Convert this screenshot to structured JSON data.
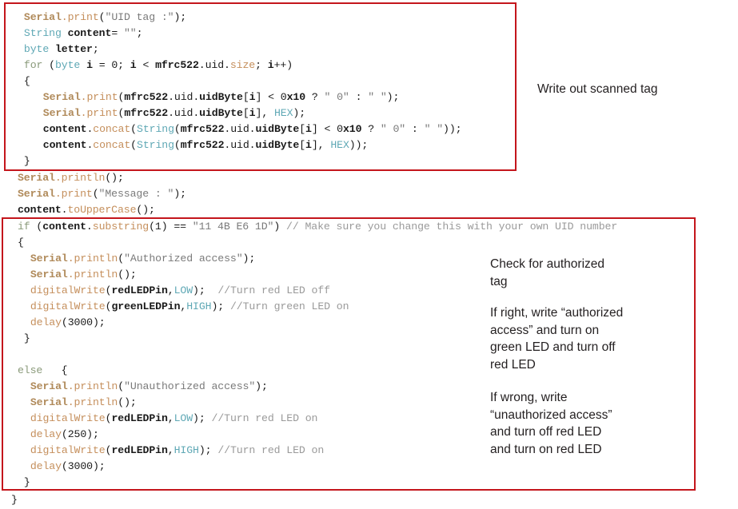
{
  "document": {
    "kind": "annotated-arduino-code-slide",
    "background_color": "#ffffff",
    "annotation_color": "#c4161c"
  },
  "code": {
    "lines": [
      {
        "indent": 2,
        "tokens": [
          {
            "text": "Serial",
            "style": "obj"
          },
          {
            "text": ".print",
            "style": "method"
          },
          {
            "text": "(",
            "style": "plain"
          },
          {
            "text": "\"UID tag :\"",
            "style": "str"
          },
          {
            "text": ");",
            "style": "plain"
          }
        ]
      },
      {
        "indent": 2,
        "tokens": [
          {
            "text": "String",
            "style": "type"
          },
          {
            "text": " ",
            "style": "plain"
          },
          {
            "text": "content",
            "style": "bold"
          },
          {
            "text": "= ",
            "style": "plain"
          },
          {
            "text": "\"\"",
            "style": "str"
          },
          {
            "text": ";",
            "style": "plain"
          }
        ]
      },
      {
        "indent": 2,
        "tokens": [
          {
            "text": "byte",
            "style": "type"
          },
          {
            "text": " ",
            "style": "plain"
          },
          {
            "text": "letter",
            "style": "bold"
          },
          {
            "text": ";",
            "style": "plain"
          }
        ]
      },
      {
        "indent": 2,
        "tokens": [
          {
            "text": "for",
            "style": "kw"
          },
          {
            "text": " (",
            "style": "plain"
          },
          {
            "text": "byte",
            "style": "type"
          },
          {
            "text": " ",
            "style": "plain"
          },
          {
            "text": "i",
            "style": "bold"
          },
          {
            "text": " = 0; ",
            "style": "plain"
          },
          {
            "text": "i",
            "style": "bold"
          },
          {
            "text": " < ",
            "style": "plain"
          },
          {
            "text": "mfrc522",
            "style": "bold"
          },
          {
            "text": ".uid.",
            "style": "plain"
          },
          {
            "text": "size",
            "style": "method"
          },
          {
            "text": "; ",
            "style": "plain"
          },
          {
            "text": "i",
            "style": "bold"
          },
          {
            "text": "++)",
            "style": "plain"
          }
        ]
      },
      {
        "indent": 2,
        "tokens": [
          {
            "text": "{",
            "style": "plain"
          }
        ]
      },
      {
        "indent": 5,
        "tokens": [
          {
            "text": "Serial",
            "style": "obj"
          },
          {
            "text": ".print",
            "style": "method"
          },
          {
            "text": "(",
            "style": "plain"
          },
          {
            "text": "mfrc522",
            "style": "bold"
          },
          {
            "text": ".uid.",
            "style": "plain"
          },
          {
            "text": "uidByte",
            "style": "bold"
          },
          {
            "text": "[",
            "style": "plain"
          },
          {
            "text": "i",
            "style": "bold"
          },
          {
            "text": "] < 0",
            "style": "plain"
          },
          {
            "text": "x10",
            "style": "bold"
          },
          {
            "text": " ? ",
            "style": "plain"
          },
          {
            "text": "\" 0\"",
            "style": "str"
          },
          {
            "text": " : ",
            "style": "plain"
          },
          {
            "text": "\" \"",
            "style": "str"
          },
          {
            "text": ");",
            "style": "plain"
          }
        ]
      },
      {
        "indent": 5,
        "tokens": [
          {
            "text": "Serial",
            "style": "obj"
          },
          {
            "text": ".print",
            "style": "method"
          },
          {
            "text": "(",
            "style": "plain"
          },
          {
            "text": "mfrc522",
            "style": "bold"
          },
          {
            "text": ".uid.",
            "style": "plain"
          },
          {
            "text": "uidByte",
            "style": "bold"
          },
          {
            "text": "[",
            "style": "plain"
          },
          {
            "text": "i",
            "style": "bold"
          },
          {
            "text": "], ",
            "style": "plain"
          },
          {
            "text": "HEX",
            "style": "type"
          },
          {
            "text": ");",
            "style": "plain"
          }
        ]
      },
      {
        "indent": 5,
        "tokens": [
          {
            "text": "content",
            "style": "bold"
          },
          {
            "text": ".",
            "style": "plain"
          },
          {
            "text": "concat",
            "style": "func"
          },
          {
            "text": "(",
            "style": "plain"
          },
          {
            "text": "String",
            "style": "type"
          },
          {
            "text": "(",
            "style": "plain"
          },
          {
            "text": "mfrc522",
            "style": "bold"
          },
          {
            "text": ".uid.",
            "style": "plain"
          },
          {
            "text": "uidByte",
            "style": "bold"
          },
          {
            "text": "[",
            "style": "plain"
          },
          {
            "text": "i",
            "style": "bold"
          },
          {
            "text": "] < 0",
            "style": "plain"
          },
          {
            "text": "x10",
            "style": "bold"
          },
          {
            "text": " ? ",
            "style": "plain"
          },
          {
            "text": "\" 0\"",
            "style": "str"
          },
          {
            "text": " : ",
            "style": "plain"
          },
          {
            "text": "\" \"",
            "style": "str"
          },
          {
            "text": "));",
            "style": "plain"
          }
        ]
      },
      {
        "indent": 5,
        "tokens": [
          {
            "text": "content",
            "style": "bold"
          },
          {
            "text": ".",
            "style": "plain"
          },
          {
            "text": "concat",
            "style": "func"
          },
          {
            "text": "(",
            "style": "plain"
          },
          {
            "text": "String",
            "style": "type"
          },
          {
            "text": "(",
            "style": "plain"
          },
          {
            "text": "mfrc522",
            "style": "bold"
          },
          {
            "text": ".uid.",
            "style": "plain"
          },
          {
            "text": "uidByte",
            "style": "bold"
          },
          {
            "text": "[",
            "style": "plain"
          },
          {
            "text": "i",
            "style": "bold"
          },
          {
            "text": "], ",
            "style": "plain"
          },
          {
            "text": "HEX",
            "style": "type"
          },
          {
            "text": "));",
            "style": "plain"
          }
        ]
      },
      {
        "indent": 2,
        "tokens": [
          {
            "text": "}",
            "style": "plain"
          }
        ]
      },
      {
        "indent": 1,
        "tokens": [
          {
            "text": "Serial",
            "style": "obj"
          },
          {
            "text": ".println",
            "style": "method"
          },
          {
            "text": "();",
            "style": "plain"
          }
        ]
      },
      {
        "indent": 1,
        "tokens": [
          {
            "text": "Serial",
            "style": "obj"
          },
          {
            "text": ".print",
            "style": "method"
          },
          {
            "text": "(",
            "style": "plain"
          },
          {
            "text": "\"Message : \"",
            "style": "str"
          },
          {
            "text": ");",
            "style": "plain"
          }
        ]
      },
      {
        "indent": 1,
        "tokens": [
          {
            "text": "content",
            "style": "bold"
          },
          {
            "text": ".",
            "style": "plain"
          },
          {
            "text": "toUpperCase",
            "style": "func"
          },
          {
            "text": "();",
            "style": "plain"
          }
        ]
      },
      {
        "indent": 1,
        "tokens": [
          {
            "text": "if",
            "style": "kw"
          },
          {
            "text": " (",
            "style": "plain"
          },
          {
            "text": "content",
            "style": "bold"
          },
          {
            "text": ".",
            "style": "plain"
          },
          {
            "text": "substring",
            "style": "func"
          },
          {
            "text": "(1) == ",
            "style": "plain"
          },
          {
            "text": "\"11 4B E6 1D\"",
            "style": "str"
          },
          {
            "text": ") ",
            "style": "plain"
          },
          {
            "text": "// Make sure you change this with your own UID number",
            "style": "comment"
          }
        ]
      },
      {
        "indent": 1,
        "tokens": [
          {
            "text": "{",
            "style": "plain"
          }
        ]
      },
      {
        "indent": 3,
        "tokens": [
          {
            "text": "Serial",
            "style": "obj"
          },
          {
            "text": ".println",
            "style": "method"
          },
          {
            "text": "(",
            "style": "plain"
          },
          {
            "text": "\"Authorized access\"",
            "style": "str"
          },
          {
            "text": ");",
            "style": "plain"
          }
        ]
      },
      {
        "indent": 3,
        "tokens": [
          {
            "text": "Serial",
            "style": "obj"
          },
          {
            "text": ".println",
            "style": "method"
          },
          {
            "text": "();",
            "style": "plain"
          }
        ]
      },
      {
        "indent": 3,
        "tokens": [
          {
            "text": "digitalWrite",
            "style": "func"
          },
          {
            "text": "(",
            "style": "plain"
          },
          {
            "text": "redLEDPin",
            "style": "bold"
          },
          {
            "text": ",",
            "style": "plain"
          },
          {
            "text": "LOW",
            "style": "type"
          },
          {
            "text": ");  ",
            "style": "plain"
          },
          {
            "text": "//Turn red LED off",
            "style": "comment"
          }
        ]
      },
      {
        "indent": 3,
        "tokens": [
          {
            "text": "digitalWrite",
            "style": "func"
          },
          {
            "text": "(",
            "style": "plain"
          },
          {
            "text": "greenLEDPin",
            "style": "bold"
          },
          {
            "text": ",",
            "style": "plain"
          },
          {
            "text": "HIGH",
            "style": "type"
          },
          {
            "text": "); ",
            "style": "plain"
          },
          {
            "text": "//Turn green LED on",
            "style": "comment"
          }
        ]
      },
      {
        "indent": 3,
        "tokens": [
          {
            "text": "delay",
            "style": "func"
          },
          {
            "text": "(3000);",
            "style": "plain"
          }
        ]
      },
      {
        "indent": 2,
        "tokens": [
          {
            "text": "}",
            "style": "plain"
          }
        ]
      },
      {
        "indent": 0,
        "tokens": []
      },
      {
        "indent": 1,
        "tokens": [
          {
            "text": "else",
            "style": "kw"
          },
          {
            "text": "   {",
            "style": "plain"
          }
        ]
      },
      {
        "indent": 3,
        "tokens": [
          {
            "text": "Serial",
            "style": "obj"
          },
          {
            "text": ".println",
            "style": "method"
          },
          {
            "text": "(",
            "style": "plain"
          },
          {
            "text": "\"Unauthorized access\"",
            "style": "str"
          },
          {
            "text": ");",
            "style": "plain"
          }
        ]
      },
      {
        "indent": 3,
        "tokens": [
          {
            "text": "Serial",
            "style": "obj"
          },
          {
            "text": ".println",
            "style": "method"
          },
          {
            "text": "();",
            "style": "plain"
          }
        ]
      },
      {
        "indent": 3,
        "tokens": [
          {
            "text": "digitalWrite",
            "style": "func"
          },
          {
            "text": "(",
            "style": "plain"
          },
          {
            "text": "redLEDPin",
            "style": "bold"
          },
          {
            "text": ",",
            "style": "plain"
          },
          {
            "text": "LOW",
            "style": "type"
          },
          {
            "text": "); ",
            "style": "plain"
          },
          {
            "text": "//Turn red LED on",
            "style": "comment"
          }
        ]
      },
      {
        "indent": 3,
        "tokens": [
          {
            "text": "delay",
            "style": "func"
          },
          {
            "text": "(250);",
            "style": "plain"
          }
        ]
      },
      {
        "indent": 3,
        "tokens": [
          {
            "text": "digitalWrite",
            "style": "func"
          },
          {
            "text": "(",
            "style": "plain"
          },
          {
            "text": "redLEDPin",
            "style": "bold"
          },
          {
            "text": ",",
            "style": "plain"
          },
          {
            "text": "HIGH",
            "style": "type"
          },
          {
            "text": "); ",
            "style": "plain"
          },
          {
            "text": "//Turn red LED on",
            "style": "comment"
          }
        ]
      },
      {
        "indent": 3,
        "tokens": [
          {
            "text": "delay",
            "style": "func"
          },
          {
            "text": "(3000);",
            "style": "plain"
          }
        ]
      },
      {
        "indent": 2,
        "tokens": [
          {
            "text": "}",
            "style": "plain"
          }
        ]
      },
      {
        "indent": 0,
        "tokens": [
          {
            "text": "}",
            "style": "plain"
          }
        ]
      }
    ],
    "line_tops": [
      12,
      32,
      52,
      72,
      92,
      112,
      132,
      152,
      172,
      192,
      213,
      233,
      253,
      274,
      294,
      314,
      334,
      354,
      374,
      394,
      414,
      434,
      454,
      474,
      494,
      514,
      534,
      554,
      574,
      594,
      616
    ]
  },
  "annotations": {
    "boxes": [
      {
        "id": "redbox-1",
        "label": "code-block-write-scanned-tag"
      },
      {
        "id": "redbox-2",
        "label": "code-block-authorization-check"
      }
    ],
    "notes": [
      {
        "id": "note-1",
        "text": "Write out scanned tag"
      },
      {
        "id": "note-2",
        "text": "Check for authorized\ntag"
      },
      {
        "id": "note-3",
        "text": "If right, write “authorized\naccess” and turn on\ngreen LED and turn off\nred LED"
      },
      {
        "id": "note-4",
        "text": "If wrong, write\n“unauthorized access”\nand turn off red LED\nand turn on red LED"
      }
    ]
  }
}
